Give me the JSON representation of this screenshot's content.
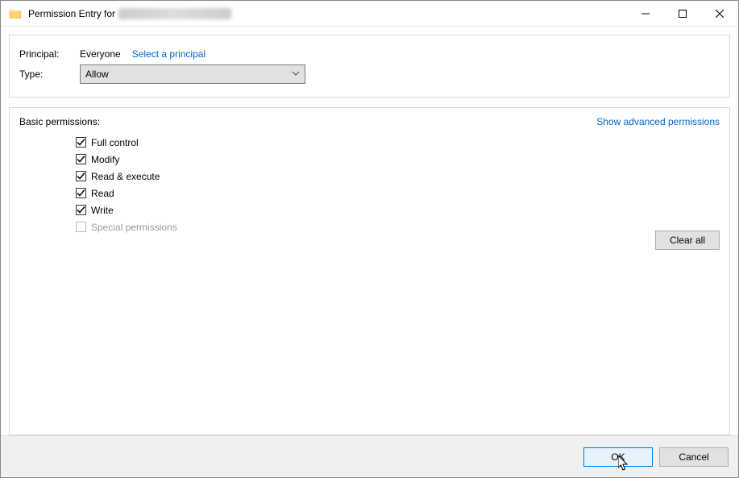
{
  "titlebar": {
    "title_prefix": "Permission Entry for"
  },
  "header": {
    "principal_label": "Principal:",
    "principal_value": "Everyone",
    "select_principal_link": "Select a principal",
    "type_label": "Type:",
    "type_value": "Allow"
  },
  "permissions": {
    "title": "Basic permissions:",
    "show_advanced_link": "Show advanced permissions",
    "items": [
      {
        "label": "Full control",
        "checked": true,
        "enabled": true
      },
      {
        "label": "Modify",
        "checked": true,
        "enabled": true
      },
      {
        "label": "Read & execute",
        "checked": true,
        "enabled": true
      },
      {
        "label": "Read",
        "checked": true,
        "enabled": true
      },
      {
        "label": "Write",
        "checked": true,
        "enabled": true
      },
      {
        "label": "Special permissions",
        "checked": false,
        "enabled": false
      }
    ],
    "clear_all_label": "Clear all"
  },
  "footer": {
    "ok_label": "OK",
    "cancel_label": "Cancel"
  }
}
